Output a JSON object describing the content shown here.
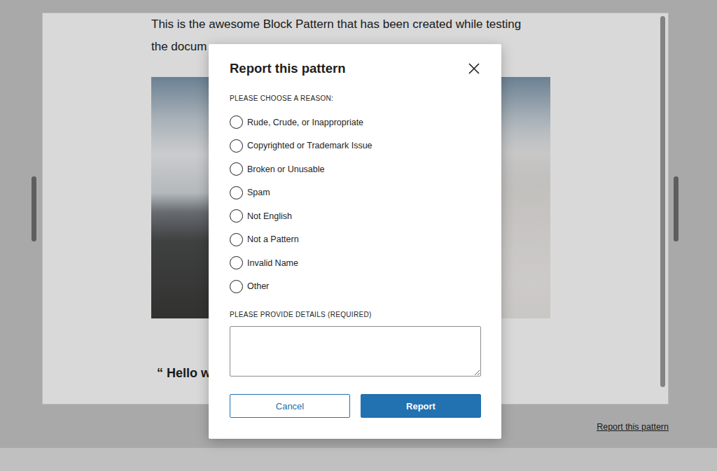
{
  "preview": {
    "paragraph_lines": [
      "This is the awesome Block Pattern that has been created while testing",
      "the docum"
    ],
    "quote": "“ Hello w"
  },
  "report_link": "Report this pattern",
  "dialog": {
    "title": "Report this pattern",
    "reason_label": "PLEASE CHOOSE A REASON:",
    "reasons": [
      {
        "label": "Rude, Crude, or Inappropriate",
        "selected": false
      },
      {
        "label": "Copyrighted or Trademark Issue",
        "selected": false
      },
      {
        "label": "Broken or Unusable",
        "selected": false
      },
      {
        "label": "Spam",
        "selected": false
      },
      {
        "label": "Not English",
        "selected": false
      },
      {
        "label": "Not a Pattern",
        "selected": false
      },
      {
        "label": "Invalid Name",
        "selected": false
      },
      {
        "label": "Other",
        "selected": false
      }
    ],
    "details_label": "PLEASE PROVIDE DETAILS (REQUIRED)",
    "buttons": [
      {
        "label": "Cancel",
        "kind": "secondary"
      },
      {
        "label": "Report",
        "kind": "primary"
      }
    ]
  }
}
